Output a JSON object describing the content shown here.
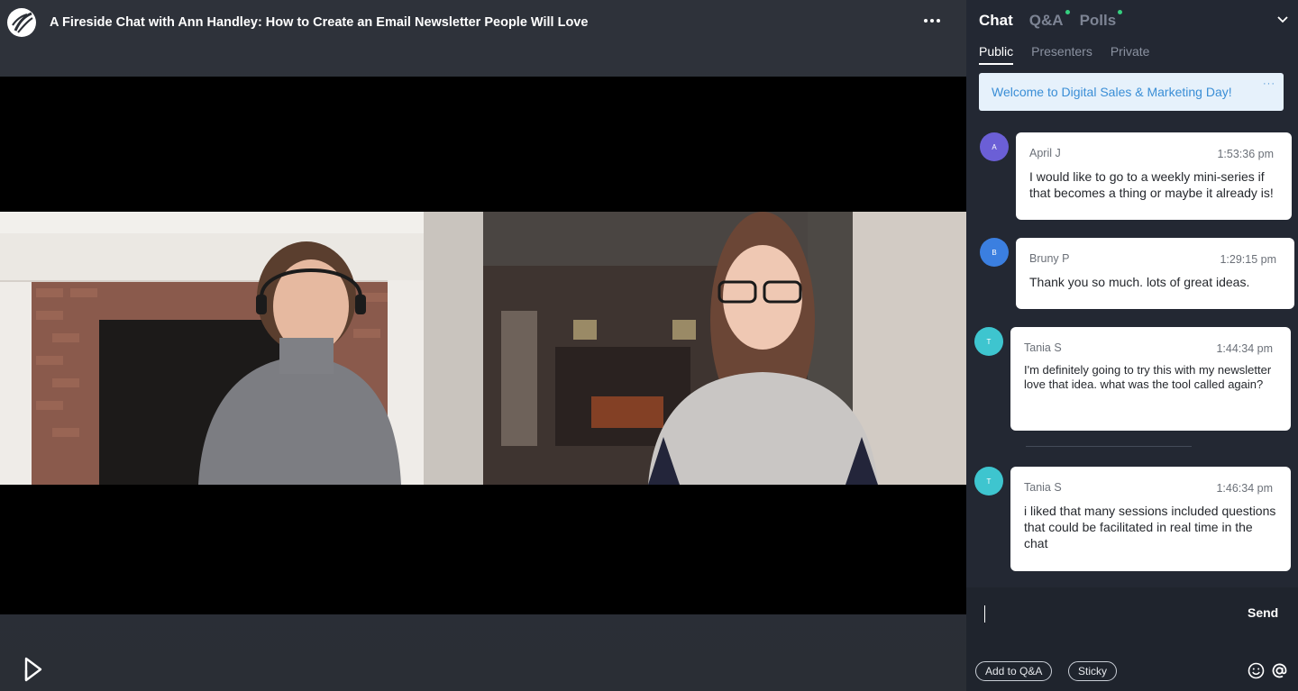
{
  "session": {
    "title": "A Fireside Chat with Ann Handley: How to Create an Email Newsletter People Will Love"
  },
  "icons": {
    "brand": "brand-logo-icon",
    "more": "more-horizontal-icon",
    "player": "player-logo-icon",
    "collapse": "chevron-down-icon",
    "emoji": "emoji-icon",
    "mention": "at-sign-icon"
  },
  "colors": {
    "accent": "#3a8ed6",
    "notification_dot": "#35d07f",
    "panel_bg": "#232833"
  },
  "panel": {
    "tabs": [
      {
        "label": "Chat",
        "active": true
      },
      {
        "label": "Q&A",
        "active": false,
        "has_dot": true
      },
      {
        "label": "Polls",
        "active": false,
        "has_dot": true
      }
    ],
    "subtabs": [
      {
        "label": "Public",
        "active": true
      },
      {
        "label": "Presenters",
        "active": false
      },
      {
        "label": "Private",
        "active": false
      }
    ],
    "welcome": "Welcome to Digital Sales & Marketing Day!",
    "welcome_more": "···",
    "messages": [
      {
        "initial": "A",
        "author": "April J",
        "time": "1:53:36 pm",
        "text": "I would like to go to a weekly mini-series if that becomes a thing or maybe it already is!",
        "avatar_color": "#6b5fd6"
      },
      {
        "initial": "B",
        "author": "Bruny P",
        "time": "1:29:15 pm",
        "text": "Thank you so much. lots of great ideas.",
        "avatar_color": "#3b7fe0"
      },
      {
        "initial": "T",
        "author": "Tania S",
        "time": "1:44:34 pm",
        "text": "I'm definitely going to try this with my newsletter love that idea. what was the tool called again?",
        "avatar_color": "#3ec5cf"
      },
      {
        "initial": "T",
        "author": "Tania S",
        "time": "1:46:34 pm",
        "text": "i liked that many sessions included questions that could be facilitated in real time in the chat",
        "avatar_color": "#3ec5cf"
      }
    ]
  },
  "compose": {
    "send_label": "Send",
    "add_qa_label": "Add to Q&A",
    "sticky_label": "Sticky"
  }
}
